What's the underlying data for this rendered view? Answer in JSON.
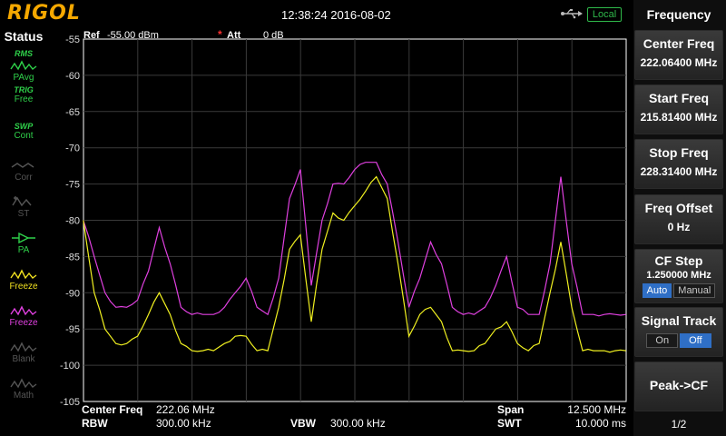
{
  "header": {
    "logo": "RIGOL",
    "timestamp": "12:38:24 2016-08-02",
    "local": "Local"
  },
  "status": {
    "title": "Status",
    "items": [
      {
        "top": "RMS",
        "bottom": "PAvg",
        "icon": "trace-rms-icon",
        "color": "#2fd14a"
      },
      {
        "top": "TRIG",
        "bottom": "Free",
        "icon": "",
        "color": "#2fd14a"
      },
      {
        "top": "SWP",
        "bottom": "Cont",
        "icon": "",
        "color": "#2fd14a"
      },
      {
        "top": "",
        "bottom": "Corr",
        "icon": "corr-icon",
        "color": "#555555"
      },
      {
        "top": "",
        "bottom": "ST",
        "icon": "st-icon",
        "color": "#555555"
      },
      {
        "top": "",
        "bottom": "PA",
        "icon": "preamp-icon",
        "color": "#2fd14a"
      },
      {
        "top": "",
        "bottom": "Freeze",
        "icon": "trace-icon",
        "color": "#f0e020"
      },
      {
        "top": "",
        "bottom": "Freeze",
        "icon": "trace-icon",
        "color": "#e040e0"
      },
      {
        "top": "",
        "bottom": "Blank",
        "icon": "trace-icon",
        "color": "#555555"
      },
      {
        "top": "",
        "bottom": "Math",
        "icon": "trace-icon",
        "color": "#555555"
      }
    ]
  },
  "plot": {
    "ref_label": "Ref",
    "ref_value": "-55.00 dBm",
    "att_label": "Att",
    "att_value": "0 dB",
    "y_ticks": [
      "-55",
      "-60",
      "-65",
      "-70",
      "-75",
      "-80",
      "-85",
      "-90",
      "-95",
      "-100",
      "-105"
    ],
    "center_label": "Center Freq",
    "center_value": "222.06 MHz",
    "span_label": "Span",
    "span_value": "12.500 MHz",
    "rbw_label": "RBW",
    "rbw_value": "300.00 kHz",
    "vbw_label": "VBW",
    "vbw_value": "300.00 kHz",
    "swt_label": "SWT",
    "swt_value": "10.000 ms",
    "colors": {
      "grid": "#3a3a3a",
      "axis": "#ffffff",
      "trace1": "#f0f020",
      "trace2": "#e040e0"
    }
  },
  "menu": {
    "title": "Frequency",
    "center_freq": {
      "label": "Center Freq",
      "value": "222.06400 MHz"
    },
    "start_freq": {
      "label": "Start Freq",
      "value": "215.81400 MHz"
    },
    "stop_freq": {
      "label": "Stop Freq",
      "value": "228.31400 MHz"
    },
    "freq_offset": {
      "label": "Freq Offset",
      "value": "0 Hz"
    },
    "cf_step": {
      "label": "CF Step",
      "value": "1.250000 MHz",
      "opt_auto": "Auto",
      "opt_manual": "Manual"
    },
    "signal_track": {
      "label": "Signal Track",
      "opt_on": "On",
      "opt_off": "Off"
    },
    "peak_cf": {
      "label": "Peak->CF"
    },
    "page": "1/2"
  },
  "chart_data": {
    "type": "line",
    "ylim": [
      -105,
      -55
    ],
    "xlim_mhz": [
      215.814,
      228.314
    ],
    "grid": true,
    "series": [
      {
        "color": "#e040e0",
        "x": [
          215.81,
          216.06,
          216.31,
          216.56,
          216.81,
          217.06,
          217.31,
          217.56,
          217.81,
          218.06,
          218.31,
          218.56,
          218.81,
          219.06,
          219.31,
          219.56,
          219.81,
          220.06,
          220.31,
          220.56,
          220.81,
          221.06,
          221.31,
          221.56,
          221.81,
          222.06,
          222.31,
          222.56,
          222.81,
          223.06,
          223.31,
          223.56,
          223.81,
          224.06,
          224.31,
          224.56,
          224.81,
          225.06,
          225.31,
          225.56,
          225.81,
          226.06,
          226.31,
          226.56,
          226.81,
          227.06,
          227.31,
          227.56,
          227.81,
          228.06,
          228.31
        ],
        "y": [
          -80,
          -85,
          -90,
          -92,
          -92,
          -91,
          -87,
          -81,
          -86,
          -92,
          -93,
          -93,
          -93,
          -92,
          -90,
          -88,
          -92,
          -93,
          -88,
          -77,
          -73,
          -89,
          -80,
          -75,
          -75,
          -73,
          -72,
          -72,
          -75,
          -83,
          -92,
          -88,
          -83,
          -86,
          -92,
          -93,
          -93,
          -92,
          -89,
          -85,
          -92,
          -93,
          -93,
          -86,
          -74,
          -86,
          -93,
          -93,
          -93,
          -93,
          -93
        ]
      },
      {
        "color": "#f0f020",
        "x": [
          215.81,
          216.06,
          216.31,
          216.56,
          216.81,
          217.06,
          217.31,
          217.56,
          217.81,
          218.06,
          218.31,
          218.56,
          218.81,
          219.06,
          219.31,
          219.56,
          219.81,
          220.06,
          220.31,
          220.56,
          220.81,
          221.06,
          221.31,
          221.56,
          221.81,
          222.06,
          222.31,
          222.56,
          222.81,
          223.06,
          223.31,
          223.56,
          223.81,
          224.06,
          224.31,
          224.56,
          224.81,
          225.06,
          225.31,
          225.56,
          225.81,
          226.06,
          226.31,
          226.56,
          226.81,
          227.06,
          227.31,
          227.56,
          227.81,
          228.06,
          228.31
        ],
        "y": [
          -80,
          -90,
          -95,
          -97,
          -97,
          -96,
          -93,
          -90,
          -93,
          -97,
          -98,
          -98,
          -98,
          -97,
          -96,
          -96,
          -98,
          -98,
          -92,
          -84,
          -82,
          -94,
          -84,
          -79,
          -80,
          -78,
          -76,
          -74,
          -77,
          -86,
          -96,
          -93,
          -92,
          -94,
          -98,
          -98,
          -98,
          -97,
          -95,
          -94,
          -97,
          -98,
          -97,
          -90,
          -83,
          -92,
          -98,
          -98,
          -98,
          -98,
          -98
        ]
      }
    ]
  }
}
